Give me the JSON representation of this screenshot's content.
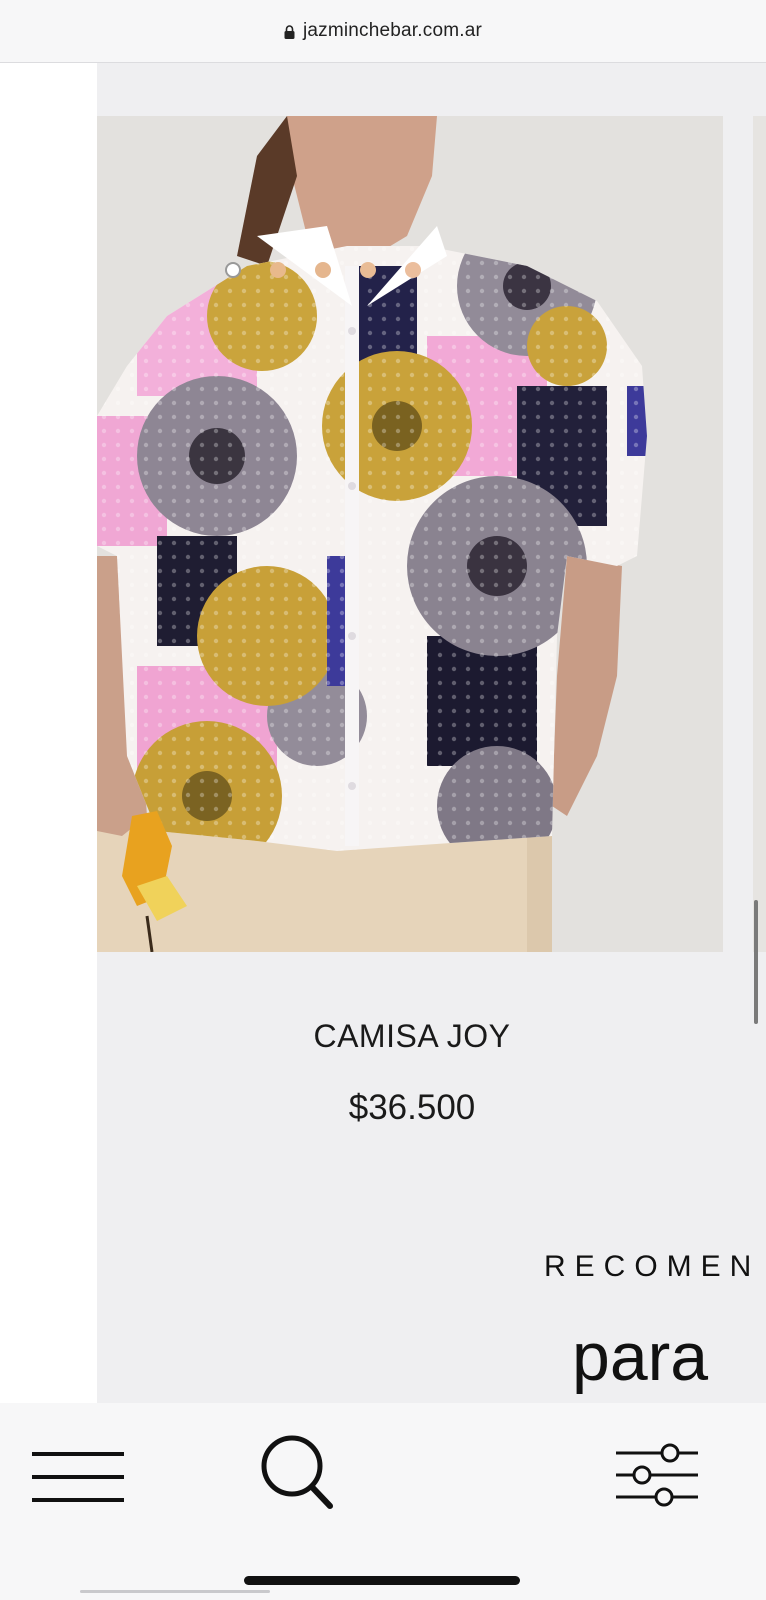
{
  "browser": {
    "url": "jazminchebar.com.ar",
    "lock_icon": "lock-icon"
  },
  "product": {
    "name": "CAMISA JOY",
    "price": "$36.500"
  },
  "section": {
    "heading_partial": "RECOMEN",
    "subheading_partial": "para"
  },
  "color_swatches": [
    "#ffffff",
    "#e8b98c",
    "#e5b68e",
    "#e9bc95",
    "#ebbe9d"
  ],
  "nav": {
    "icons": [
      "menu-icon",
      "search-icon",
      "filter-icon"
    ]
  }
}
